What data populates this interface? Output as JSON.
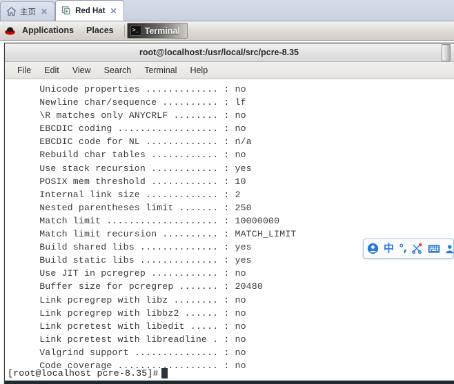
{
  "tabbar": {
    "tabs": [
      {
        "label": "主页",
        "icon": "home-icon",
        "close": "✕",
        "active": false
      },
      {
        "label": "Red Hat",
        "icon": "virtual-machine-icon",
        "close": "✕",
        "active": true
      }
    ]
  },
  "panel": {
    "logo_icon": "red-hat-logo-icon",
    "applications": "Applications",
    "places": "Places",
    "taskbar": {
      "terminal_label": "Terminal",
      "terminal_icon": "terminal-icon",
      "terminal_icon_glyph": ">_"
    }
  },
  "terminal": {
    "title": "root@localhost:/usr/local/src/pcre-8.35",
    "menu": [
      "File",
      "Edit",
      "View",
      "Search",
      "Terminal",
      "Help"
    ],
    "lines": [
      "  Unicode properties ............. : no",
      "  Newline char/sequence .......... : lf",
      "  \\R matches only ANYCRLF ........ : no",
      "  EBCDIC coding .................. : no",
      "  EBCDIC code for NL ............. : n/a",
      "  Rebuild char tables ............ : no",
      "  Use stack recursion ............ : yes",
      "  POSIX mem threshold ............ : 10",
      "  Internal link size ............. : 2",
      "  Nested parentheses limit ....... : 250",
      "  Match limit .................... : 10000000",
      "  Match limit recursion .......... : MATCH_LIMIT",
      "  Build shared libs .............. : yes",
      "  Build static libs .............. : yes",
      "  Use JIT in pcregrep ............ : no",
      "  Buffer size for pcregrep ....... : 20480",
      "  Link pcregrep with libz ........ : no",
      "  Link pcregrep with libbz2 ...... : no",
      "  Link pcretest with libedit ..... : no",
      "  Link pcretest with libreadline . : no",
      "  Valgrind support ............... : no",
      "  Code coverage .................. : no"
    ],
    "prompt": "[root@localhost pcre-8.35]#",
    "cursor_char": "█"
  },
  "ime": {
    "icons": [
      "sogou-user-icon",
      "chinese-mode-icon",
      "punctuation-mode-icon",
      "scissors-icon",
      "soft-keyboard-icon",
      "user-profile-icon"
    ],
    "chinese_label": "中",
    "punctuation_label": "°,"
  },
  "colors": {
    "accent_blue": "#2878d8",
    "panel_bg": "#dedbd6",
    "terminal_bg": "#ffffff",
    "terminal_fg": "#3a3a3a",
    "cursor": "#2b3539",
    "redhat_red": "#cc0000"
  }
}
